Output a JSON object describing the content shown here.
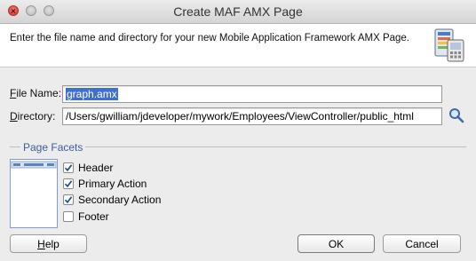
{
  "window": {
    "title": "Create MAF AMX Page"
  },
  "header": {
    "description": "Enter the file name and directory for your new Mobile Application Framework AMX Page.",
    "icon": "mobile-page-wizard-icon"
  },
  "form": {
    "file_name": {
      "label_key": "F",
      "label_rest": "ile Name:",
      "value": "graph.amx"
    },
    "directory": {
      "label_key": "D",
      "label_rest": "irectory:",
      "value": "/Users/gwilliam/jdeveloper/mywork/Employees/ViewController/public_html",
      "browse_icon": "search-icon"
    }
  },
  "facets": {
    "title": "Page Facets",
    "options": [
      {
        "label": "Header",
        "checked": true
      },
      {
        "label": "Primary Action",
        "checked": true
      },
      {
        "label": "Secondary Action",
        "checked": true
      },
      {
        "label": "Footer",
        "checked": false
      }
    ]
  },
  "buttons": {
    "help_key": "H",
    "help_rest": "elp",
    "ok": "OK",
    "cancel": "Cancel"
  }
}
